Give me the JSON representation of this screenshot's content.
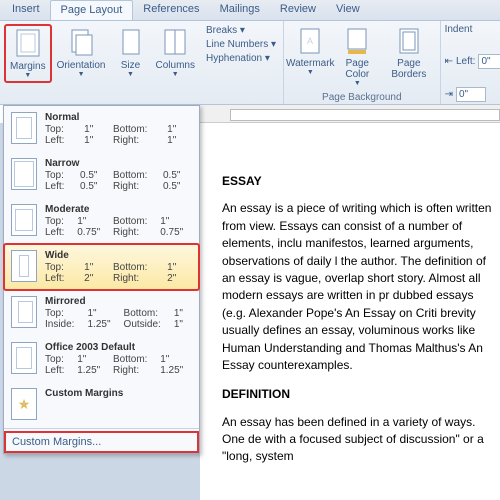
{
  "tabs": [
    "Insert",
    "Page Layout",
    "References",
    "Mailings",
    "Review",
    "View"
  ],
  "activeTab": 1,
  "ribbon": {
    "pageSetup": {
      "margins": "Margins",
      "orientation": "Orientation",
      "size": "Size",
      "columns": "Columns",
      "breaks": "Breaks ▾",
      "lineNumbers": "Line Numbers ▾",
      "hyphenation": "Hyphenation ▾"
    },
    "pageBackground": {
      "label": "Page Background",
      "watermark": "Watermark",
      "pageColor": "Page Color",
      "pageBorders": "Page Borders"
    },
    "paragraph": {
      "indentLabel": "Indent",
      "leftLabel": "Left:",
      "leftVal": "0\"",
      "rightVal": "0\""
    }
  },
  "marginsMenu": {
    "options": [
      {
        "name": "Normal",
        "iconClass": "normal",
        "l1a": "Top:",
        "l1av": "1\"",
        "l1b": "Bottom:",
        "l1bv": "1\"",
        "l2a": "Left:",
        "l2av": "1\"",
        "l2b": "Right:",
        "l2bv": "1\""
      },
      {
        "name": "Narrow",
        "iconClass": "narrow",
        "l1a": "Top:",
        "l1av": "0.5\"",
        "l1b": "Bottom:",
        "l1bv": "0.5\"",
        "l2a": "Left:",
        "l2av": "0.5\"",
        "l2b": "Right:",
        "l2bv": "0.5\""
      },
      {
        "name": "Moderate",
        "iconClass": "moderate",
        "l1a": "Top:",
        "l1av": "1\"",
        "l1b": "Bottom:",
        "l1bv": "1\"",
        "l2a": "Left:",
        "l2av": "0.75\"",
        "l2b": "Right:",
        "l2bv": "0.75\""
      },
      {
        "name": "Wide",
        "iconClass": "wide",
        "l1a": "Top:",
        "l1av": "1\"",
        "l1b": "Bottom:",
        "l1bv": "1\"",
        "l2a": "Left:",
        "l2av": "2\"",
        "l2b": "Right:",
        "l2bv": "2\""
      },
      {
        "name": "Mirrored",
        "iconClass": "mirrored",
        "l1a": "Top:",
        "l1av": "1\"",
        "l1b": "Bottom:",
        "l1bv": "1\"",
        "l2a": "Inside:",
        "l2av": "1.25\"",
        "l2b": "Outside:",
        "l2bv": "1\""
      },
      {
        "name": "Office 2003 Default",
        "iconClass": "normal",
        "l1a": "Top:",
        "l1av": "1\"",
        "l1b": "Bottom:",
        "l1bv": "1\"",
        "l2a": "Left:",
        "l2av": "1.25\"",
        "l2b": "Right:",
        "l2bv": "1.25\""
      }
    ],
    "customLabel": "Custom Margins",
    "customMenu": "Custom Margins..."
  },
  "document": {
    "h1": "ESSAY",
    "p1": "An essay is a piece of writing which is often written from view. Essays can consist of a number of elements, inclu manifestos, learned arguments, observations of daily l the author. The definition of an essay is vague, overlap short story. Almost all modern essays are written in pr dubbed essays (e.g. Alexander Pope's An Essay on Criti brevity usually defines an essay, voluminous works like Human Understanding and Thomas Malthus's An Essay counterexamples.",
    "h2": "DEFINITION",
    "p2": "An essay has been defined in a variety of ways. One de with a focused subject of discussion\" or a \"long, system"
  }
}
